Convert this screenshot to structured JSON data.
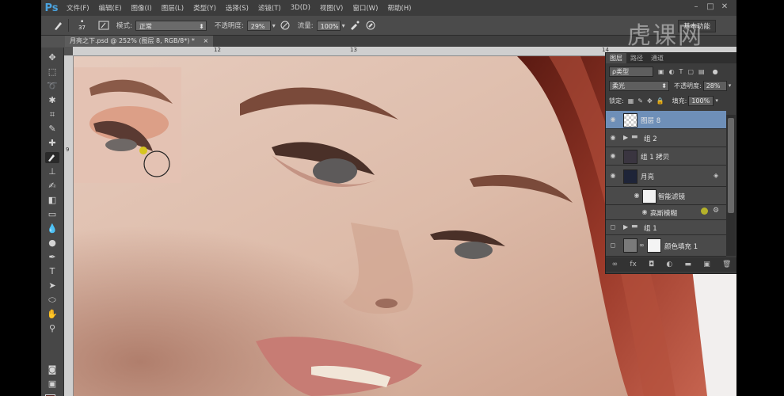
{
  "menubar": {
    "logo": "Ps",
    "items": [
      "文件(F)",
      "编辑(E)",
      "图像(I)",
      "图层(L)",
      "类型(Y)",
      "选择(S)",
      "滤镜(T)",
      "3D(D)",
      "视图(V)",
      "窗口(W)",
      "帮助(H)"
    ]
  },
  "options": {
    "brush_size": "37",
    "mode_label": "模式:",
    "mode_value": "正常",
    "opacity_label": "不透明度:",
    "opacity_value": "29%",
    "flow_label": "流量:",
    "flow_value": "100%",
    "workspace": "基本功能"
  },
  "document": {
    "tab_title": "月亮之下.psd @ 252% (图层 8, RGB/8*) *",
    "close": "×"
  },
  "rulers": {
    "top": [
      "12",
      "13",
      "14"
    ],
    "left": [
      "9"
    ]
  },
  "layers_panel": {
    "tabs": [
      "图层",
      "路径",
      "通道"
    ],
    "filter_label": "ρ类型",
    "blend_mode": "柔光",
    "opacity_label": "不透明度:",
    "opacity_value": "28%",
    "lock_label": "锁定:",
    "fill_label": "填充:",
    "fill_value": "100%",
    "layers": [
      {
        "name": "图层 8",
        "selected": true
      },
      {
        "name": "组 2"
      },
      {
        "name": "组 1 拷贝"
      },
      {
        "name": "月亮"
      },
      {
        "name": "智能滤镜"
      },
      {
        "name": "高斯模糊"
      },
      {
        "name": "组 1"
      },
      {
        "name": "颜色填充 1"
      }
    ]
  },
  "watermark": "虎课网",
  "colors": {
    "foreground": "#4a1410",
    "background": "#ffffff",
    "selected_layer": "#6e8fb8"
  }
}
